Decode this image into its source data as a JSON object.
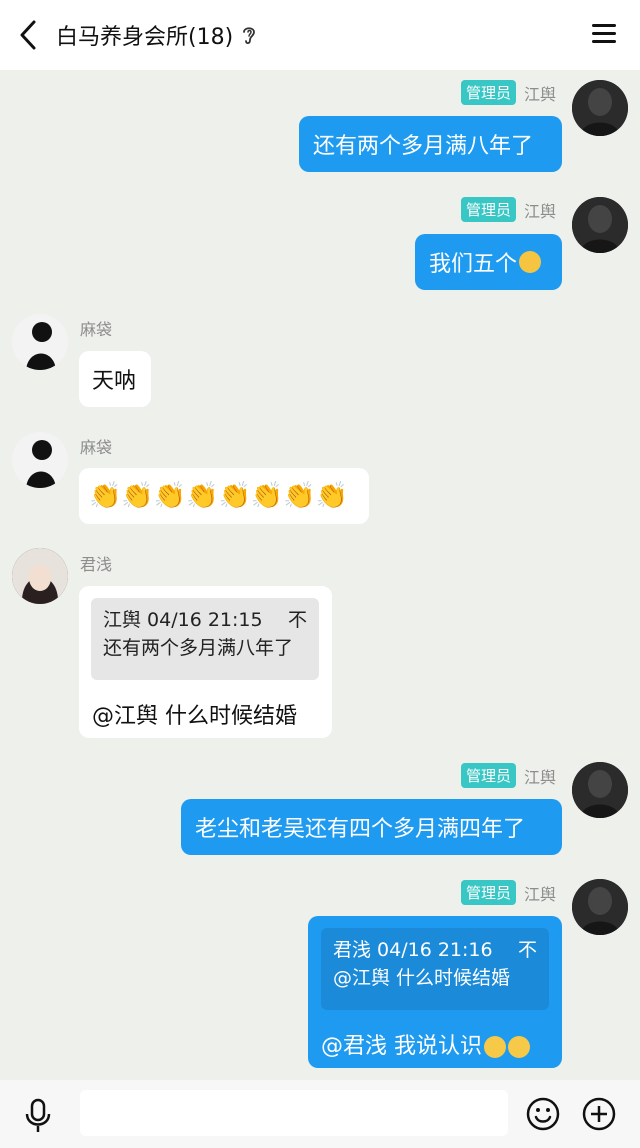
{
  "header": {
    "title": "白马养身会所(18)",
    "ear_icon": "ear-icon"
  },
  "admin_badge": "管理员",
  "messages": [
    {
      "sender": "江舆",
      "text": "还有两个多月满八年了"
    },
    {
      "sender": "江舆",
      "text": "我们五个"
    },
    {
      "sender": "麻袋",
      "text": "天呐"
    },
    {
      "sender": "麻袋",
      "text": "👏👏👏👏👏👏👏👏"
    },
    {
      "sender": "君浅",
      "quote_head": "江舆 04/16 21:15",
      "quote_mark": "不",
      "quote_text": "还有两个多月满八年了",
      "text": "@江舆 什么时候结婚"
    },
    {
      "sender": "江舆",
      "text": "老尘和老吴还有四个多月满四年了"
    },
    {
      "sender": "江舆",
      "quote_head": "君浅 04/16 21:16",
      "quote_mark": "不",
      "quote_text": "@江舆 什么时候结婚",
      "text": "@君浅 我说认识"
    }
  ],
  "colors": {
    "outgoing": "#1e9bf0",
    "incoming": "#ffffff",
    "badge": "#38c7c5",
    "background": "#eef0ec"
  }
}
